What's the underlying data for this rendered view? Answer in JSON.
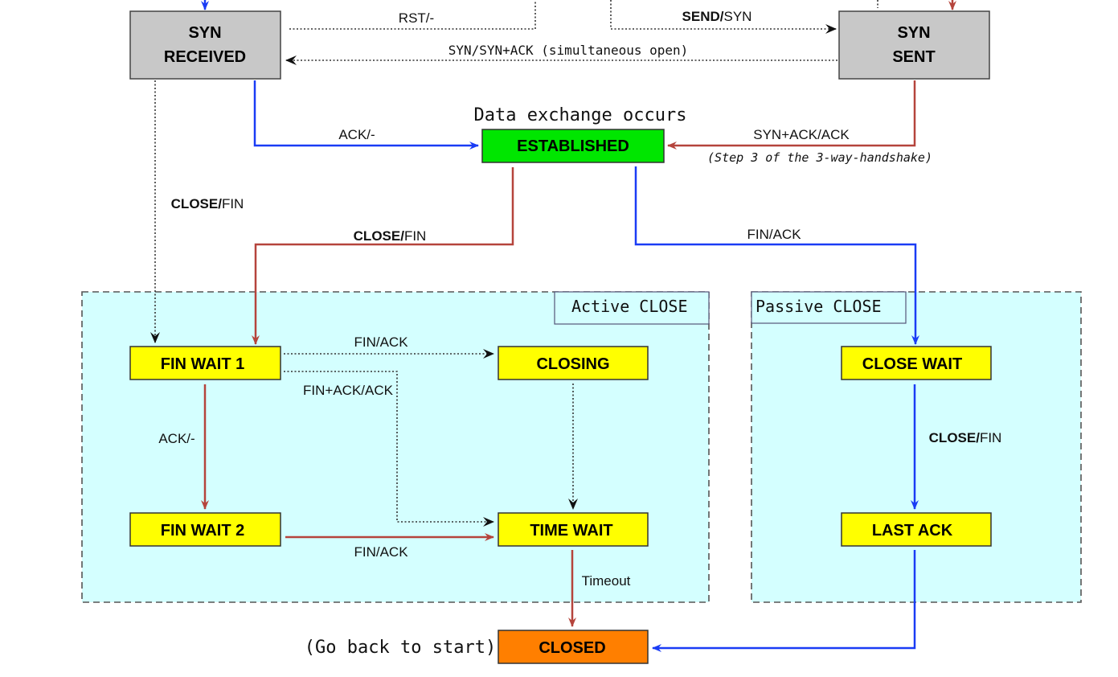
{
  "states": {
    "syn_received": [
      "SYN",
      "RECEIVED"
    ],
    "syn_sent": [
      "SYN",
      "SENT"
    ],
    "established": "ESTABLISHED",
    "fin_wait_1": "FIN WAIT 1",
    "fin_wait_2": "FIN WAIT 2",
    "closing": "CLOSING",
    "time_wait": "TIME WAIT",
    "close_wait": "CLOSE WAIT",
    "last_ack": "LAST ACK",
    "closed": "CLOSED"
  },
  "regions": {
    "active": "Active CLOSE",
    "passive": "Passive CLOSE"
  },
  "annotations": {
    "data_exchange": "Data exchange occurs",
    "step3": "(Step 3 of the 3-way-handshake)",
    "go_back": "(Go back to start)"
  },
  "transitions": {
    "rst": "RST/-",
    "send_syn": {
      "event": "SEND/",
      "action": "SYN"
    },
    "simultaneous_open": "SYN/SYN+ACK (simultaneous open)",
    "ack_established": "ACK/-",
    "synack_ack": "SYN+ACK/ACK",
    "close_fin_synrcvd": {
      "event": "CLOSE/",
      "action": "FIN"
    },
    "close_fin_established": {
      "event": "CLOSE/",
      "action": "FIN"
    },
    "fin_ack_passive": "FIN/ACK",
    "fin_ack_closing": "FIN/ACK",
    "finack_ack": "FIN+ACK/ACK",
    "ack_finwait2": "ACK/-",
    "fin_ack_timewait": "FIN/ACK",
    "timeout": "Timeout",
    "close_fin_closewait": {
      "event": "CLOSE/",
      "action": "FIN"
    }
  },
  "colors": {
    "blue_arrow": "#1a3cf5",
    "red_arrow": "#b5443c",
    "syn_box": "#c8c8c8",
    "established": "#00e600",
    "wait_box": "#ffff00",
    "closed": "#ff7f00",
    "region": "#d4ffff"
  }
}
